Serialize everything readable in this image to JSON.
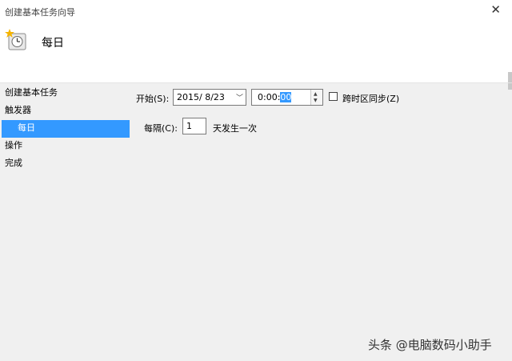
{
  "window": {
    "title": "创建基本任务向导",
    "close": "✕"
  },
  "header": {
    "title": "每日"
  },
  "nav": {
    "items": [
      "创建基本任务",
      "触发器",
      "每日",
      "操作",
      "完成"
    ]
  },
  "form": {
    "start_label": "开始(S):",
    "date_value": "2015/  8/23",
    "time_prefix": "0:00:",
    "time_selected": "00",
    "sync_tz_label": "跨时区同步(Z)",
    "recur_label": "每隔(C):",
    "recur_value": "1",
    "recur_suffix": "天发生一次"
  },
  "watermark": "头条 @电脑数码小助手"
}
